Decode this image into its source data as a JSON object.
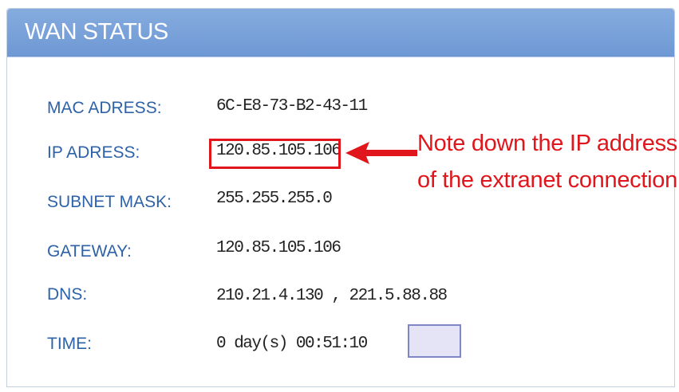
{
  "panel": {
    "title": "WAN STATUS"
  },
  "rows": [
    {
      "label": "MAC ADRESS:",
      "value": "6C-E8-73-B2-43-11"
    },
    {
      "label": "IP ADRESS:",
      "value": "120.85.105.106"
    },
    {
      "label": "SUBNET MASK:",
      "value": "255.255.255.0"
    },
    {
      "label": "GATEWAY:",
      "value": "120.85.105.106"
    },
    {
      "label": "DNS:",
      "value": "210.21.4.130 , 221.5.88.88"
    },
    {
      "label": "TIME:",
      "value": "0 day(s) 00:51:10"
    }
  ],
  "annotation": {
    "line1": "Note down the IP address",
    "line2": "of the extranet connection"
  },
  "colors": {
    "header": "#7aa2da",
    "label": "#2e62a8",
    "annotation": "#e0161c"
  }
}
